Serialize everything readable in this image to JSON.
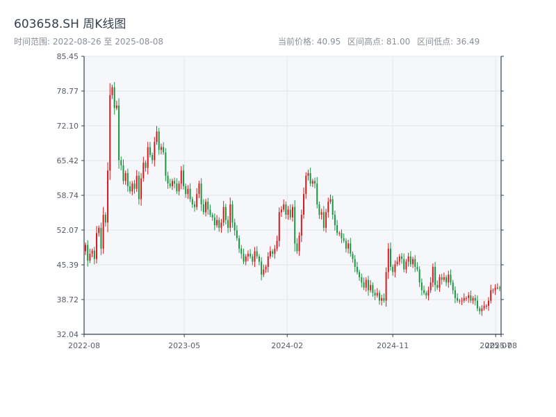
{
  "header": {
    "title": "603658.SH 周K线图",
    "time_range": "时间范围: 2022-08-26 至 2025-08-08",
    "current_price": "当前价格: 40.95",
    "range_high": "区间高点: 81.00",
    "range_low": "区间低点: 36.49"
  },
  "chart_data": {
    "type": "candlestick",
    "title": "603658.SH 周K线图",
    "colors": {
      "up": "#d7191c",
      "down": "#1a9641",
      "grid": "#e3e6ea",
      "plot_bg": "#f5f7fa",
      "axis": "#333f4d"
    },
    "ylim": [
      32.04,
      85.45
    ],
    "yticks": [
      "32.04",
      "38.72",
      "45.39",
      "52.07",
      "58.74",
      "65.42",
      "72.10",
      "78.77",
      "85.45"
    ],
    "xlim": [
      "2022-08-26",
      "2025-08-08"
    ],
    "xticks": [
      {
        "date": "2022-08-26",
        "label": "2022-08"
      },
      {
        "date": "2023-05-12",
        "label": "2023-05"
      },
      {
        "date": "2024-02-02",
        "label": "2024-02"
      },
      {
        "date": "2024-11-01",
        "label": "2024-11"
      },
      {
        "date": "2025-07-25",
        "label": "2025-07"
      },
      {
        "date": "2025-08-08",
        "label": "2025-08"
      }
    ],
    "candles_close": [
      49.2,
      46.2,
      47.5,
      48.1,
      46.5,
      51.5,
      52.5,
      48.5,
      55.0,
      53.5,
      63.5,
      78.0,
      79.5,
      75.5,
      76.0,
      65.5,
      64.5,
      61.5,
      63.0,
      60.5,
      59.5,
      61.0,
      60.0,
      62.5,
      58.0,
      62.0,
      65.0,
      64.0,
      68.0,
      66.5,
      65.5,
      69.0,
      71.0,
      67.5,
      68.0,
      67.0,
      62.5,
      61.0,
      60.5,
      61.5,
      61.0,
      59.5,
      61.0,
      63.5,
      60.5,
      59.0,
      60.0,
      58.0,
      57.0,
      56.5,
      59.0,
      61.0,
      57.0,
      55.5,
      57.5,
      56.0,
      55.0,
      54.5,
      53.0,
      54.0,
      52.5,
      53.5,
      56.5,
      54.0,
      52.5,
      57.0,
      53.5,
      52.0,
      50.5,
      48.5,
      47.5,
      46.0,
      47.0,
      47.5,
      47.0,
      46.0,
      48.0,
      47.0,
      46.0,
      43.5,
      44.5,
      45.0,
      47.0,
      48.0,
      47.5,
      48.5,
      50.0,
      55.5,
      56.0,
      57.0,
      55.0,
      56.0,
      54.5,
      56.5,
      49.5,
      48.0,
      51.0,
      55.0,
      59.0,
      62.5,
      63.0,
      61.0,
      61.5,
      61.0,
      57.0,
      55.0,
      55.5,
      52.5,
      55.5,
      57.5,
      58.0,
      55.0,
      53.0,
      51.5,
      51.5,
      50.5,
      50.0,
      48.5,
      49.5,
      47.5,
      46.5,
      45.0,
      44.0,
      43.0,
      42.0,
      41.0,
      42.5,
      40.5,
      41.5,
      40.0,
      39.5,
      40.0,
      38.5,
      39.0,
      38.5,
      44.0,
      48.5,
      45.0,
      44.0,
      45.5,
      46.0,
      47.0,
      46.5,
      44.5,
      46.0,
      47.0,
      45.5,
      46.5,
      45.0,
      44.5,
      42.0,
      40.5,
      40.0,
      39.5,
      40.5,
      42.0,
      45.0,
      41.5,
      41.0,
      43.0,
      42.5,
      43.0,
      42.0,
      43.5,
      42.0,
      40.5,
      39.0,
      38.5,
      38.5,
      38.5,
      39.0,
      39.0,
      39.5,
      38.5,
      39.0,
      38.5,
      37.0,
      36.5,
      37.0,
      37.5,
      37.5,
      38.5,
      40.5,
      40.5,
      41.0,
      41.0,
      40.95
    ],
    "candle_note": "weekly candles; open = previous close, high/low approximated"
  }
}
